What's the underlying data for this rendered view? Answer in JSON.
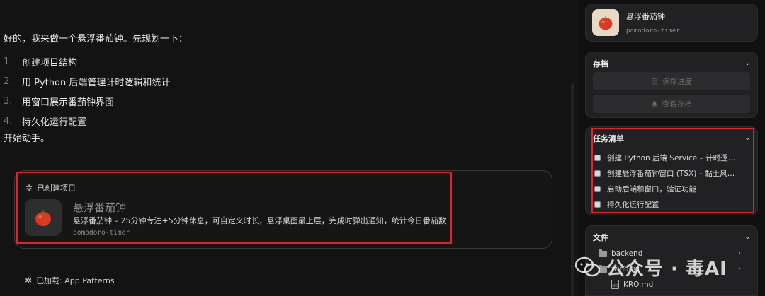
{
  "chat": {
    "intro": "好的，我来做一个悬浮番茄钟。先规划一下：",
    "steps": [
      {
        "num": "1.",
        "text": "创建项目结构"
      },
      {
        "num": "2.",
        "text": "用 Python 后端管理计时逻辑和统计"
      },
      {
        "num": "3.",
        "text": "用窗口展示番茄钟界面"
      },
      {
        "num": "4.",
        "text": "持久化运行配置"
      }
    ],
    "outro": "开始动手。",
    "project_card": {
      "header": "已创建项目",
      "title": "悬浮番茄钟",
      "description": "悬浮番茄钟 – 25分钟专注+5分钟休息，可自定义时长，悬浮桌面最上层，完成时弹出通知，统计今日番茄数",
      "id": "pomodoro-timer"
    },
    "loaded": "已加载: App Patterns"
  },
  "sidebar": {
    "app": {
      "title": "悬浮番茄钟",
      "id": "pomodoro-timer"
    },
    "save": {
      "title": "存档",
      "save_button": "保存进度",
      "view_button": "查看存档"
    },
    "tasks": {
      "title": "任务清单",
      "items": [
        "创建 Python 后端 Service – 计时逻…",
        "创建悬浮番茄钟窗口 (TSX) – 黏土风…",
        "启动后端和窗口，验证功能",
        "持久化运行配置"
      ]
    },
    "files": {
      "title": "文件",
      "items": [
        {
          "name": "backend",
          "type": "folder"
        },
        {
          "name": "window",
          "type": "folder"
        },
        {
          "name": "KRO.md",
          "type": "md"
        }
      ]
    }
  },
  "watermark": "公众号 · 毒AI",
  "colors": {
    "highlight": "#d9262f",
    "background": "#131314",
    "panel": "#212123"
  }
}
